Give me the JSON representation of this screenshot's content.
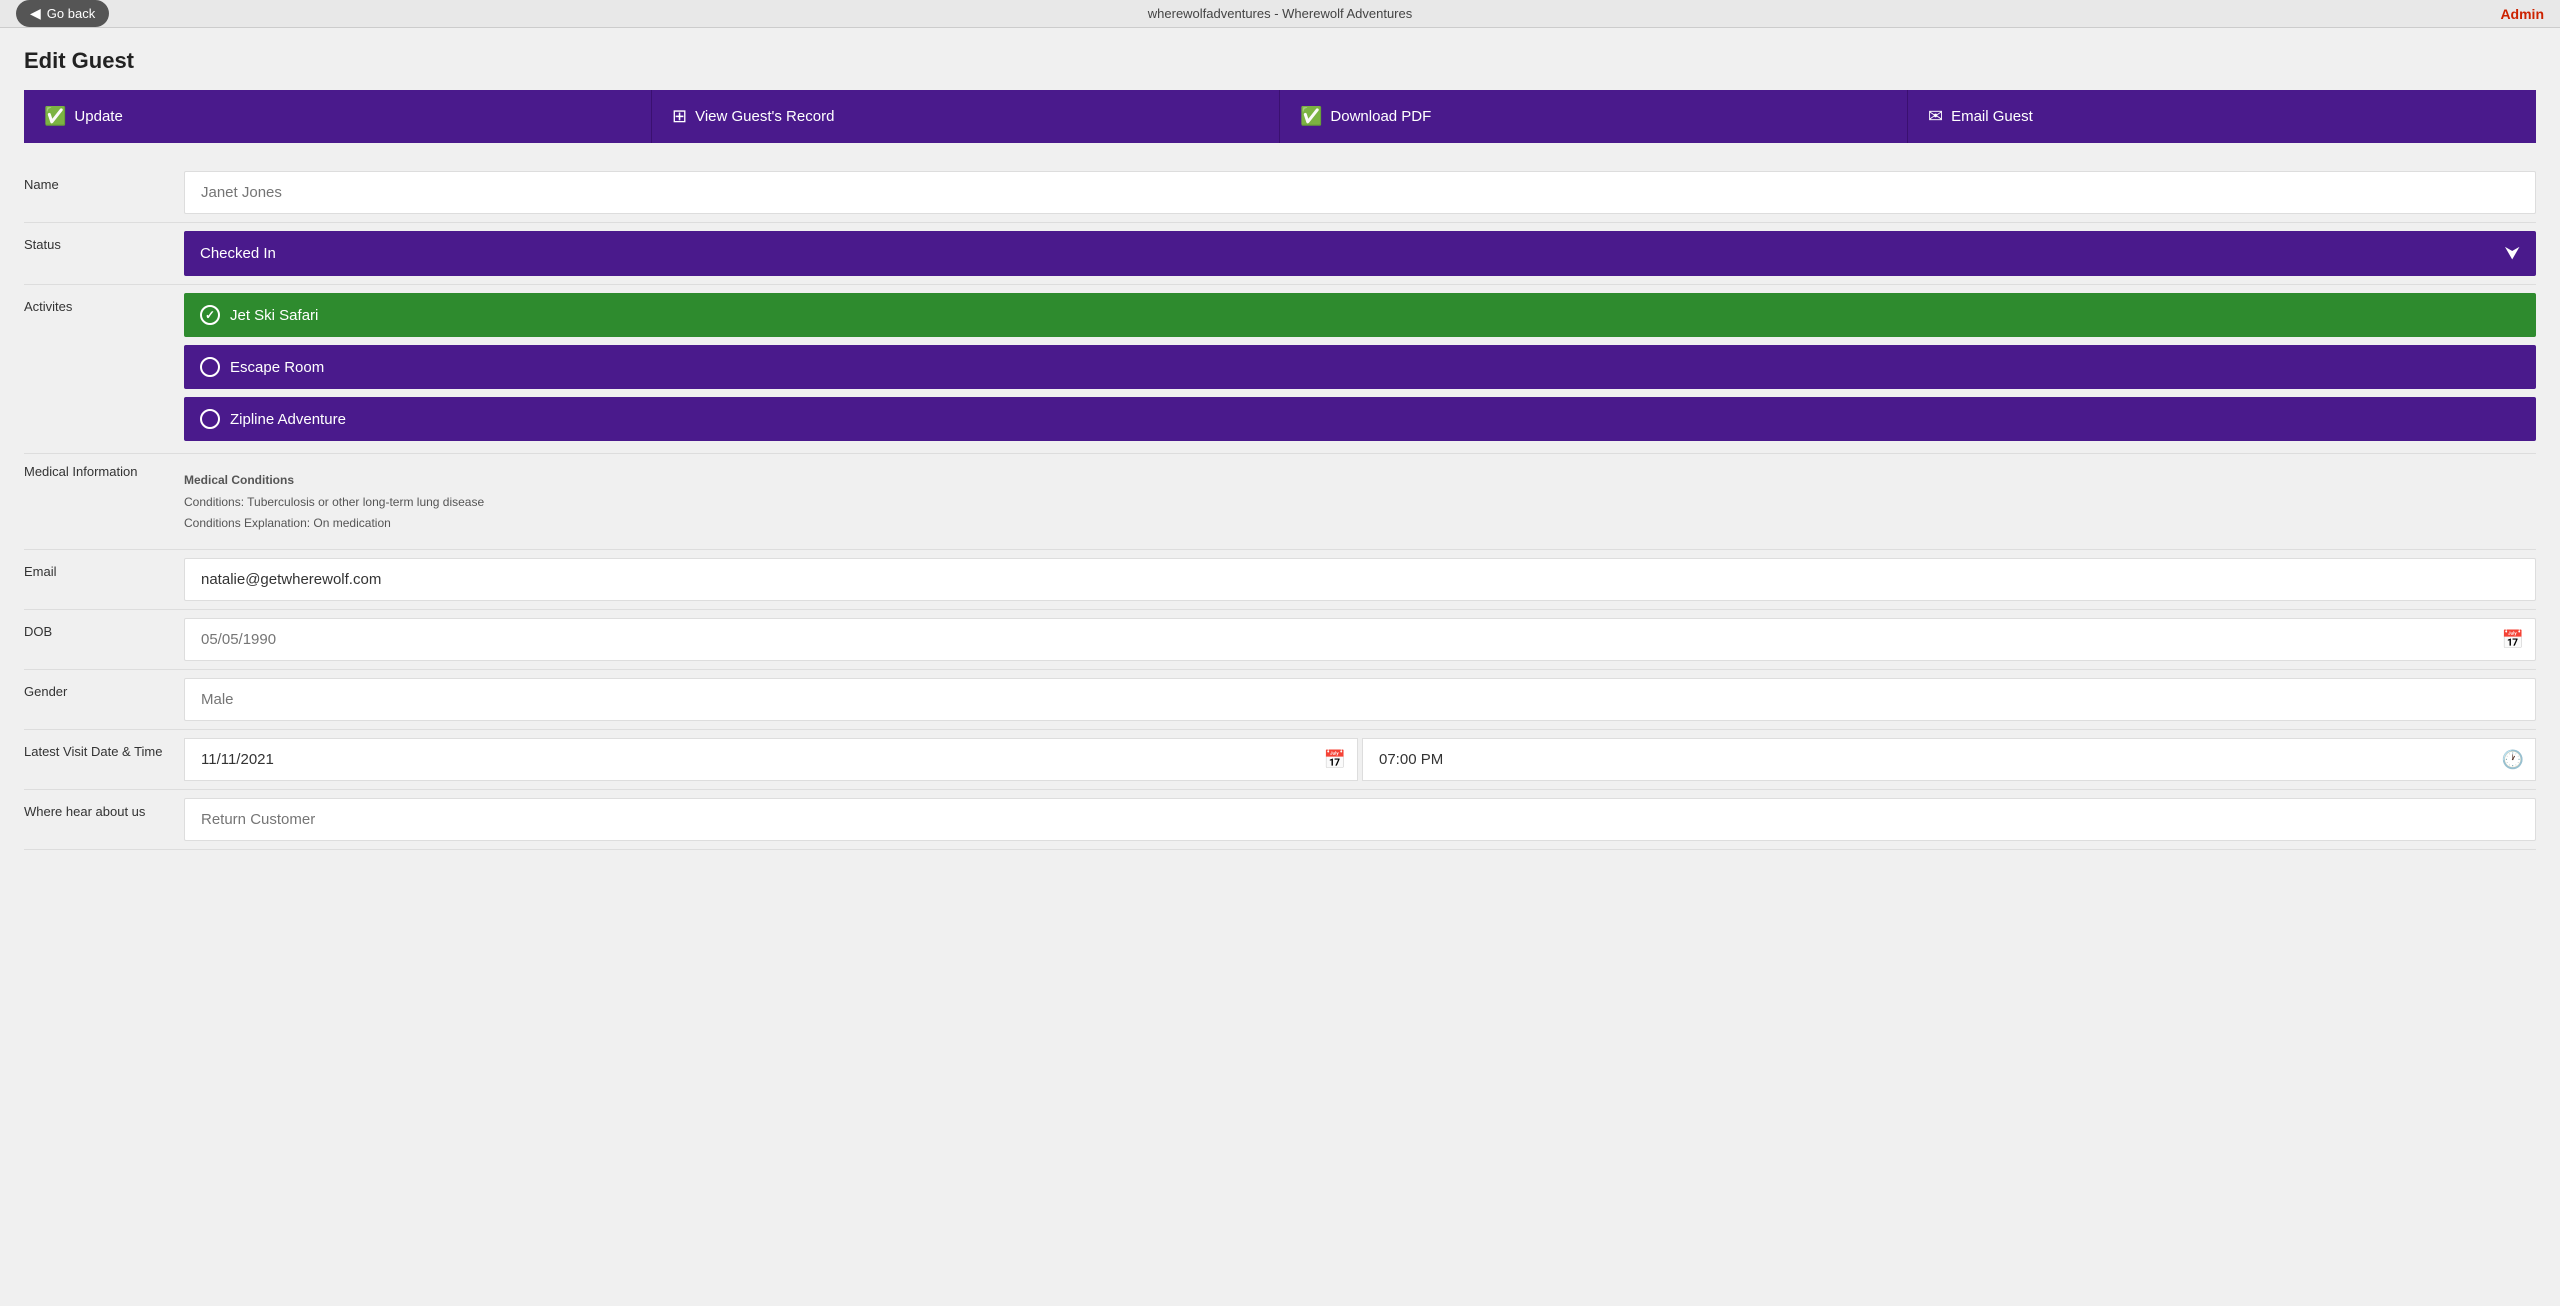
{
  "topBar": {
    "title": "wherewolfadventures - Wherewolf Adventures",
    "goBackLabel": "Go back",
    "adminLabel": "Admin"
  },
  "pageTitle": "Edit Guest",
  "actionButtons": [
    {
      "id": "update",
      "label": "Update",
      "icon": "✔"
    },
    {
      "id": "view-guests-record",
      "label": "View Guest's Record",
      "icon": "⊕"
    },
    {
      "id": "download-pdf",
      "label": "Download PDF",
      "icon": "✔"
    },
    {
      "id": "email-guest",
      "label": "Email Guest",
      "icon": "✉"
    }
  ],
  "form": {
    "name": {
      "label": "Name",
      "placeholder": "Janet Jones",
      "value": ""
    },
    "status": {
      "label": "Status",
      "value": "Checked In"
    },
    "activities": {
      "label": "Activites",
      "items": [
        {
          "name": "Jet Ski Safari",
          "selected": true
        },
        {
          "name": "Escape Room",
          "selected": false
        },
        {
          "name": "Zipline Adventure",
          "selected": false
        }
      ]
    },
    "medicalInformation": {
      "label": "Medical Information",
      "title": "Medical Conditions",
      "conditions": "Conditions: Tuberculosis or other long-term lung disease",
      "explanation": "Conditions Explanation: On medication"
    },
    "email": {
      "label": "Email",
      "value": "natalie@getwherewolf.com"
    },
    "dob": {
      "label": "DOB",
      "placeholder": "05/05/1990",
      "value": ""
    },
    "gender": {
      "label": "Gender",
      "placeholder": "Male",
      "value": ""
    },
    "latestVisit": {
      "label": "Latest Visit Date & Time",
      "dateValue": "11/11/2021",
      "timeValue": "07:00 PM"
    },
    "whereHearAboutUs": {
      "label": "Where hear about us",
      "placeholder": "Return Customer",
      "value": ""
    }
  },
  "colors": {
    "purple": "#4a1a8c",
    "green": "#2e8b2e",
    "adminRed": "#cc2200"
  }
}
